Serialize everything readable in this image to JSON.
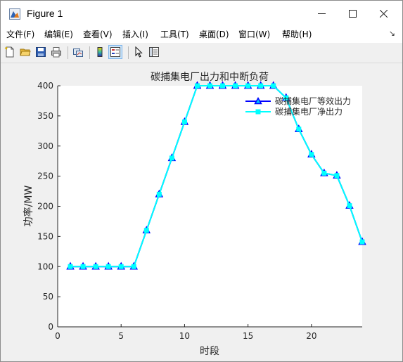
{
  "window": {
    "title": "Figure 1"
  },
  "menu": [
    "文件(F)",
    "编辑(E)",
    "查看(V)",
    "插入(I)",
    "工具(T)",
    "桌面(D)",
    "窗口(W)",
    "帮助(H)"
  ],
  "toolbar": [
    "new-figure-icon",
    "open-file-icon",
    "save-icon",
    "print-icon",
    "link-plot-icon",
    "insert-colorbar-icon",
    "insert-legend-icon",
    "edit-plot-icon",
    "property-inspector-icon"
  ],
  "colors": {
    "series1": "#0000ff",
    "series1_marker": "#00bfff",
    "series2": "#00ffff"
  },
  "chart_data": {
    "type": "line",
    "title": "碳捕集电厂出力和中断负荷",
    "xlabel": "时段",
    "ylabel": "功率/MW",
    "xlim": [
      0,
      24
    ],
    "ylim": [
      0,
      400
    ],
    "xticks": [
      0,
      5,
      10,
      15,
      20
    ],
    "yticks": [
      0,
      50,
      100,
      150,
      200,
      250,
      300,
      350,
      400
    ],
    "x": [
      1,
      2,
      3,
      4,
      5,
      6,
      7,
      8,
      9,
      10,
      11,
      12,
      13,
      14,
      15,
      16,
      17,
      18,
      19,
      20,
      21,
      22,
      23,
      24
    ],
    "series": [
      {
        "name": "碳捕集电厂等效出力",
        "marker": "triangle",
        "values": [
          100,
          100,
          100,
          100,
          100,
          100,
          160,
          220,
          280,
          340,
          400,
          400,
          400,
          400,
          400,
          400,
          400,
          380,
          328,
          286,
          255,
          251,
          201,
          141
        ]
      },
      {
        "name": "碳捕集电厂净出力",
        "marker": "square",
        "values": [
          100,
          100,
          100,
          100,
          100,
          100,
          160,
          220,
          280,
          340,
          400,
          400,
          400,
          400,
          400,
          400,
          400,
          380,
          328,
          286,
          255,
          251,
          201,
          141
        ]
      }
    ],
    "legend": "top-right",
    "grid": false
  }
}
